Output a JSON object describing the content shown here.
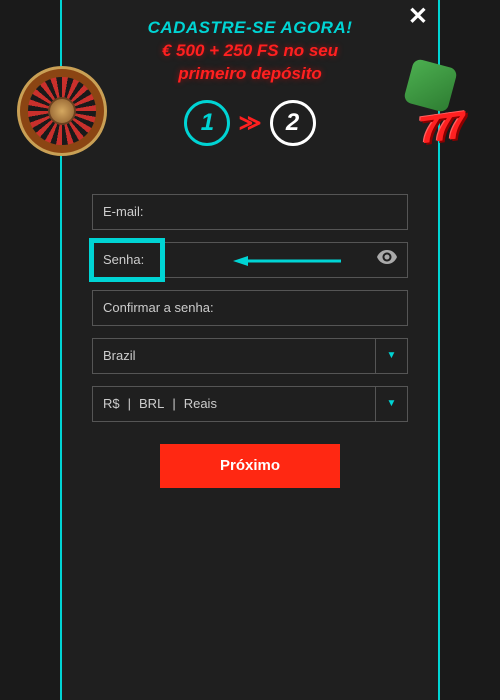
{
  "header": {
    "title": "CADASTRE-SE AGORA!",
    "subtitle_line1": "€ 500 + 250 FS no seu",
    "subtitle_line2": "primeiro depósito",
    "sevens": "777"
  },
  "steps": {
    "step1": "1",
    "arrow": "≫",
    "step2": "2"
  },
  "form": {
    "email_label": "E-mail:",
    "password_label": "Senha:",
    "confirm_password_label": "Confirmar a senha:",
    "country_value": "Brazil",
    "currency_symbol": "R$",
    "currency_code": "BRL",
    "currency_name": "Reais",
    "submit_label": "Próximo"
  },
  "icons": {
    "close": "✕",
    "caret": "▼"
  }
}
